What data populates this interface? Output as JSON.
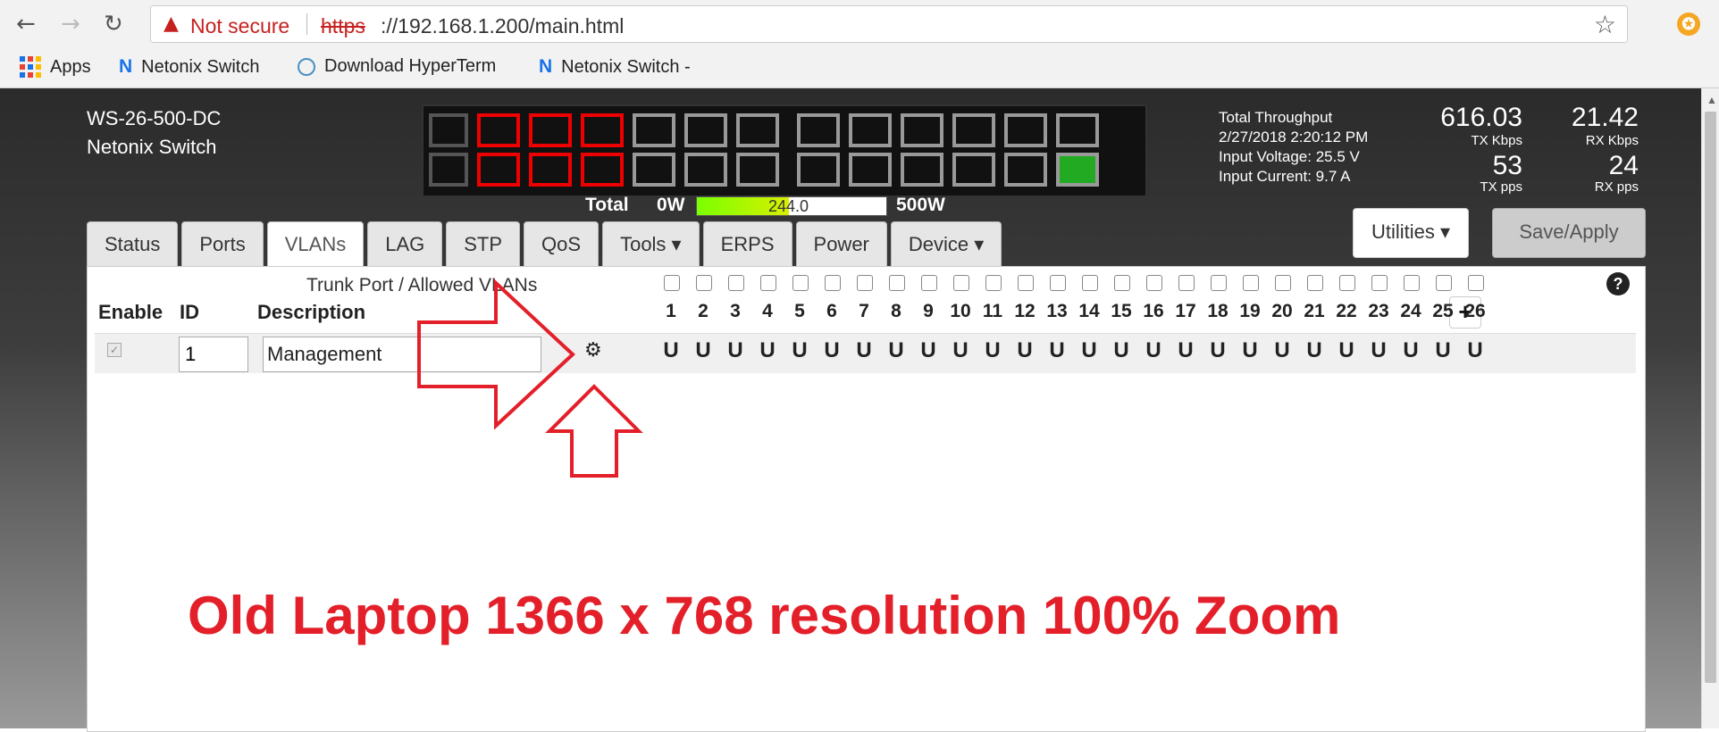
{
  "browser": {
    "security_label": "Not secure",
    "url_scheme": "https",
    "url_rest": "://192.168.1.200/main.html",
    "bookmarks": [
      {
        "label": "Apps"
      },
      {
        "label": "Netonix Switch"
      },
      {
        "label": "Download HyperTerm"
      },
      {
        "label": "Netonix Switch -"
      }
    ]
  },
  "device": {
    "model": "WS-26-500-DC",
    "name": "Netonix Switch"
  },
  "power": {
    "total_label": "Total",
    "min_label": "0W",
    "max_label": "500W",
    "value": "244.0",
    "fraction": 0.488
  },
  "stats": {
    "throughput_label": "Total Throughput",
    "timestamp": "2/27/2018 2:20:12 PM",
    "voltage": "Input Voltage: 25.5 V",
    "current": "Input Current: 9.7 A",
    "tx_kbps": "616.03",
    "tx_kbps_label": "TX Kbps",
    "rx_kbps": "21.42",
    "rx_kbps_label": "RX Kbps",
    "tx_pps": "53",
    "tx_pps_label": "TX pps",
    "rx_pps": "24",
    "rx_pps_label": "RX pps"
  },
  "buttons": {
    "utilities": "Utilities ▾",
    "save": "Save/Apply"
  },
  "tabs": [
    {
      "label": "Status"
    },
    {
      "label": "Ports"
    },
    {
      "label": "VLANs",
      "active": true
    },
    {
      "label": "LAG"
    },
    {
      "label": "STP"
    },
    {
      "label": "QoS"
    },
    {
      "label": "Tools ▾"
    },
    {
      "label": "ERPS"
    },
    {
      "label": "Power"
    },
    {
      "label": "Device ▾"
    }
  ],
  "vlan_table": {
    "trunk_label": "Trunk Port / Allowed VLANs",
    "headers": {
      "enable": "Enable",
      "id": "ID",
      "description": "Description"
    },
    "port_numbers": [
      "1",
      "2",
      "3",
      "4",
      "5",
      "6",
      "7",
      "8",
      "9",
      "10",
      "11",
      "12",
      "13",
      "14",
      "15",
      "16",
      "17",
      "18",
      "19",
      "20",
      "21",
      "22",
      "23",
      "24",
      "25",
      "26"
    ],
    "add_label": "+",
    "help_label": "?",
    "rows": [
      {
        "enabled": true,
        "id": "1",
        "description": "Management",
        "membership": [
          "U",
          "U",
          "U",
          "U",
          "U",
          "U",
          "U",
          "U",
          "U",
          "U",
          "U",
          "U",
          "U",
          "U",
          "U",
          "U",
          "U",
          "U",
          "U",
          "U",
          "U",
          "U",
          "U",
          "U",
          "U",
          "U"
        ]
      }
    ]
  },
  "annotation": {
    "text": "Old Laptop 1366 x 768 resolution 100% Zoom",
    "color": "#e3202a"
  }
}
